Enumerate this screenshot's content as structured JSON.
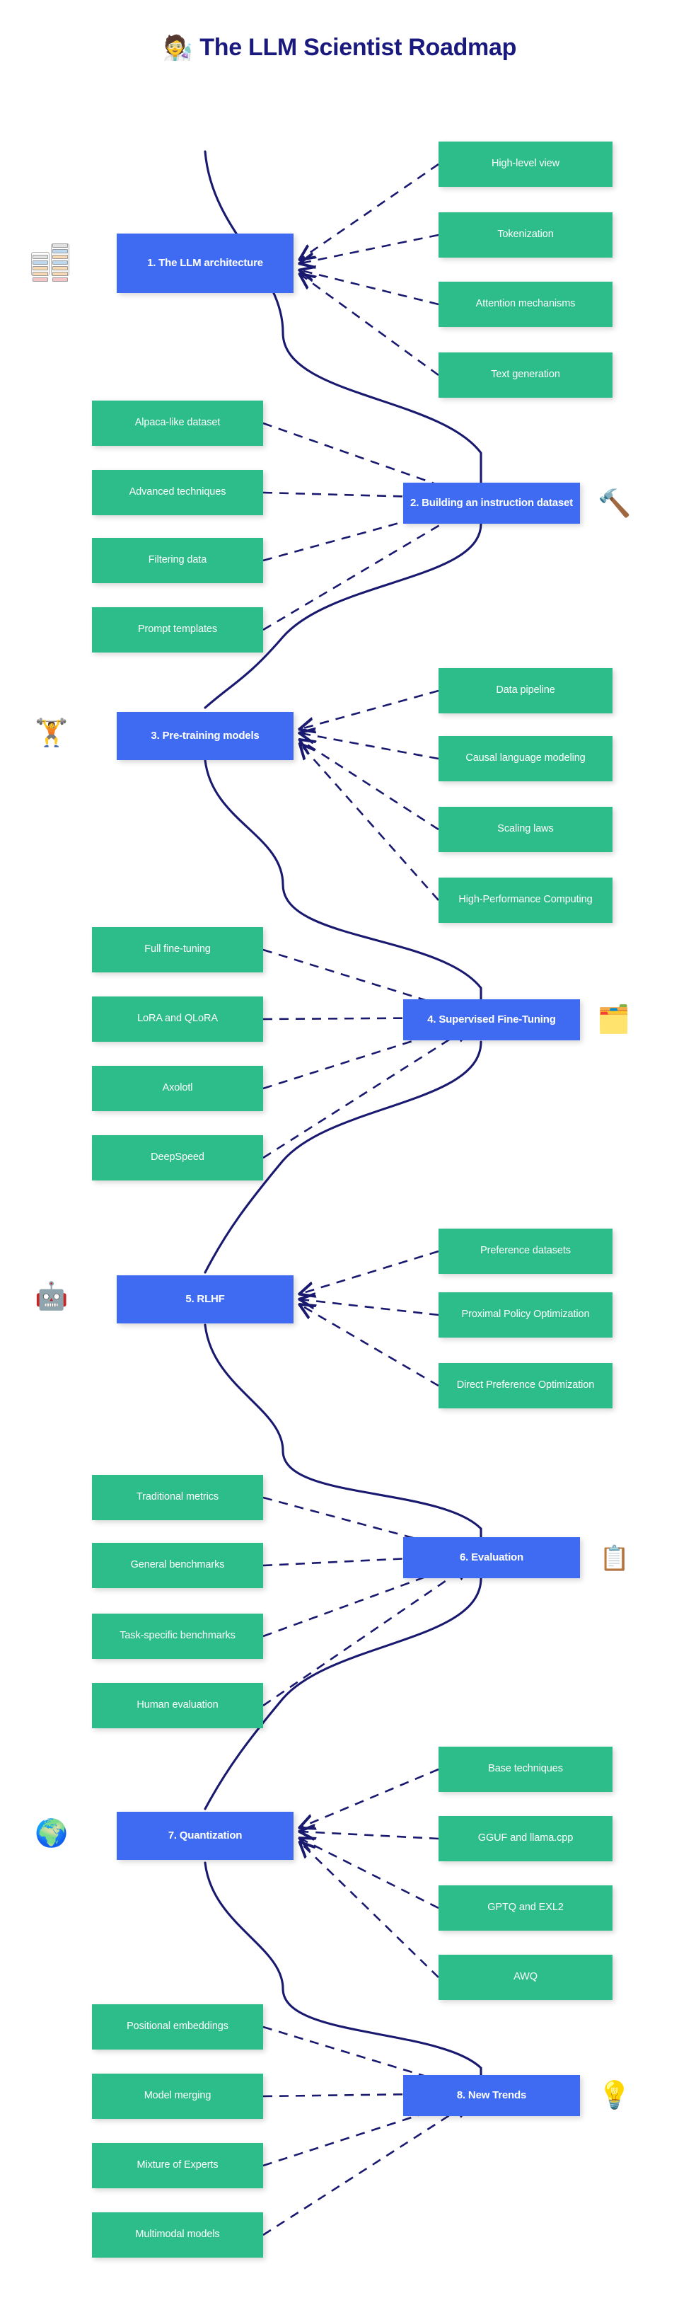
{
  "header": {
    "emoji": "🧑‍🔬",
    "emoji_name": "scientist-emoji",
    "title": "The LLM Scientist Roadmap",
    "title_color": "#1a197e"
  },
  "theme": {
    "background": "#ffffff",
    "main_node_color": "#3f6bf2",
    "leaf_node_color": "#2dbd8a",
    "edge_color": "#191970",
    "node_text_color": "#ffffff"
  },
  "sections": [
    {
      "id": "llm-architecture",
      "number": "1.",
      "label": "1. The LLM architecture",
      "icon": "transformer-architecture-diagram",
      "icon_emoji": "",
      "side": "left",
      "children": [
        "High-level view",
        "Tokenization",
        "Attention mechanisms",
        "Text generation"
      ]
    },
    {
      "id": "building-instruction-dataset",
      "number": "2.",
      "label": "2. Building an instruction dataset",
      "icon": "hammer-emoji",
      "icon_emoji": "🔨",
      "side": "right",
      "children": [
        "Alpaca-like dataset",
        "Advanced techniques",
        "Filtering data",
        "Prompt templates"
      ]
    },
    {
      "id": "pre-training-models",
      "number": "3.",
      "label": "3. Pre-training models",
      "icon": "robot-weightlifter-emoji",
      "icon_emoji": "🏋️",
      "side": "left",
      "children": [
        "Data pipeline",
        "Causal language modeling",
        "Scaling laws",
        "High-Performance Computing"
      ]
    },
    {
      "id": "supervised-fine-tuning",
      "number": "4.",
      "label": "4. Supervised Fine-Tuning",
      "icon": "whiteboard-easel-emoji",
      "icon_emoji": "🗂️",
      "side": "right",
      "children": [
        "Full fine-tuning",
        "LoRA and QLoRA",
        "Axolotl",
        "DeepSpeed"
      ]
    },
    {
      "id": "rlhf",
      "number": "5.",
      "label": "5. RLHF",
      "icon": "robot-with-checkmark-emoji",
      "icon_emoji": "🤖",
      "side": "left",
      "children": [
        "Preference datasets",
        "Proximal Policy Optimization",
        "Direct Preference Optimization"
      ]
    },
    {
      "id": "evaluation",
      "number": "6.",
      "label": "6. Evaluation",
      "icon": "checklist-document-emoji",
      "icon_emoji": "📋",
      "side": "right",
      "children": [
        "Traditional metrics",
        "General benchmarks",
        "Task-specific benchmarks",
        "Human evaluation"
      ]
    },
    {
      "id": "quantization",
      "number": "7.",
      "label": "7. Quantization",
      "icon": "colorful-globe-emoji",
      "icon_emoji": "🌍",
      "side": "left",
      "children": [
        "Base techniques",
        "GGUF and llama.cpp",
        "GPTQ and EXL2",
        "AWQ"
      ]
    },
    {
      "id": "new-trends",
      "number": "8.",
      "label": "8. New Trends",
      "icon": "lightbulb-emoji",
      "icon_emoji": "💡",
      "side": "right",
      "children": [
        "Positional embeddings",
        "Model merging",
        "Mixture of Experts",
        "Multimodal models"
      ]
    }
  ]
}
